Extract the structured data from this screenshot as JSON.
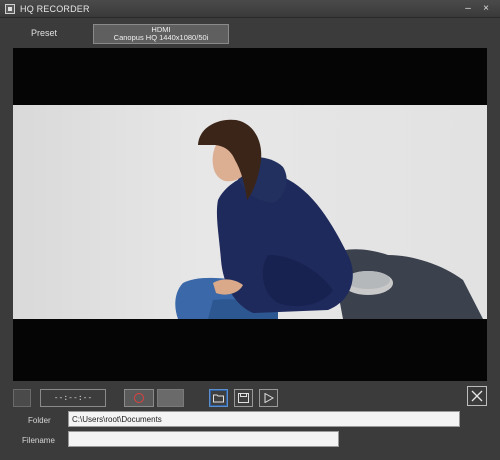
{
  "window": {
    "title": "HQ RECORDER",
    "minimize_glyph": "–",
    "close_glyph": "×"
  },
  "preset": {
    "label": "Preset",
    "line1": "HDMI",
    "line2": "Canopus HQ 1440x1080/50i"
  },
  "transport": {
    "timecode": "--:--:--",
    "record_color": "#e04040"
  },
  "fields": {
    "folder_label": "Folder",
    "folder_value": "C:\\Users\\root\\Documents",
    "filename_label": "Filename",
    "filename_value": "",
    "browse_label": "..."
  },
  "icons": {
    "folder": "folder-icon",
    "save": "save-icon",
    "play": "play-icon",
    "close": "close-icon"
  }
}
